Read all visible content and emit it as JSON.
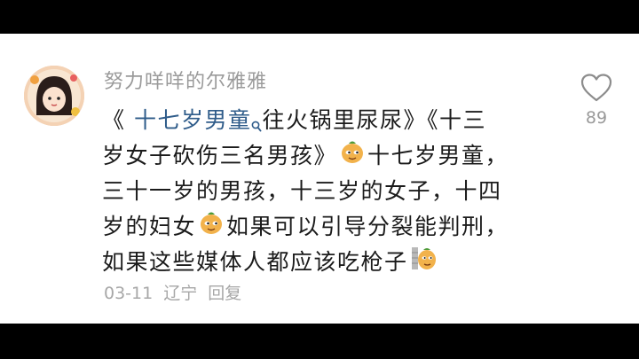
{
  "comment": {
    "username": "努力咩咩的尔雅雅",
    "lines": [
      {
        "open": "《 ",
        "link": "十七岁男童",
        "rest": "往火锅里尿尿》《十三"
      },
      {
        "text": "岁女子砍伤三名男孩》",
        "after": "十七岁男童，"
      },
      {
        "text": "三十一岁的男孩，十三岁的女子，十四"
      },
      {
        "text": "岁的妇女",
        "after": "如果可以引导分裂能判刑，"
      },
      {
        "text": "如果这些媒体人都应该吃枪子"
      }
    ],
    "date": "03-11",
    "location": "辽宁",
    "reply_label": "回复",
    "like_count": "89",
    "icons": {
      "like": "heart-outline-icon",
      "link_search": "search-icon",
      "emoji_1": "doge-emoji-icon",
      "emoji_2": "doge-emoji-icon",
      "emoji_3": "wall-peek-emoji-icon"
    },
    "colors": {
      "link": "#2f5c8a",
      "text": "#1b1b1b",
      "muted": "#9a9a9a",
      "background": "#ffffff",
      "letterbox": "#000000"
    }
  }
}
